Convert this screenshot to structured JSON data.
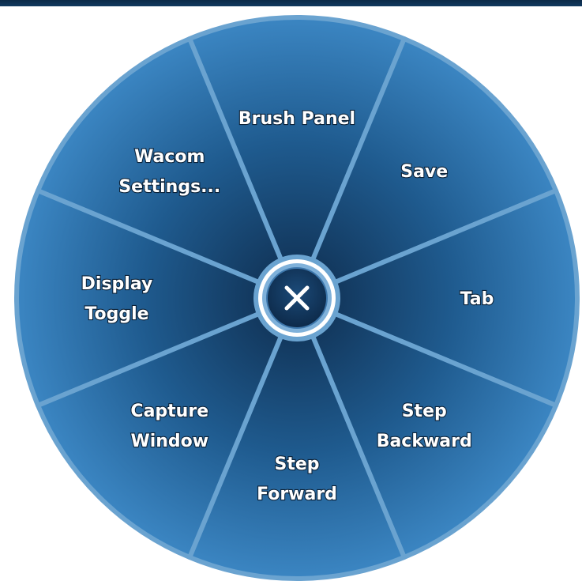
{
  "radial_menu": {
    "close_icon": "close-icon",
    "wedges": [
      {
        "id": "brush-panel",
        "lines": [
          "Brush Panel"
        ]
      },
      {
        "id": "save",
        "lines": [
          "Save"
        ]
      },
      {
        "id": "tab",
        "lines": [
          "Tab"
        ]
      },
      {
        "id": "step-backward",
        "lines": [
          "Step",
          "Backward"
        ]
      },
      {
        "id": "step-forward",
        "lines": [
          "Step",
          "Forward"
        ]
      },
      {
        "id": "capture-window",
        "lines": [
          "Capture",
          "Window"
        ]
      },
      {
        "id": "display-toggle",
        "lines": [
          "Display",
          "Toggle"
        ]
      },
      {
        "id": "wacom-settings",
        "lines": [
          "Wacom",
          "Settings..."
        ]
      }
    ]
  },
  "colors": {
    "wedge_dark": "#0e2c4d",
    "wedge_mid": "#1f5b8f",
    "wedge_light": "#3c87c4",
    "separator": "#6aa3d0",
    "label_text": "#ffffff",
    "header_bar": "#0c2a47"
  }
}
